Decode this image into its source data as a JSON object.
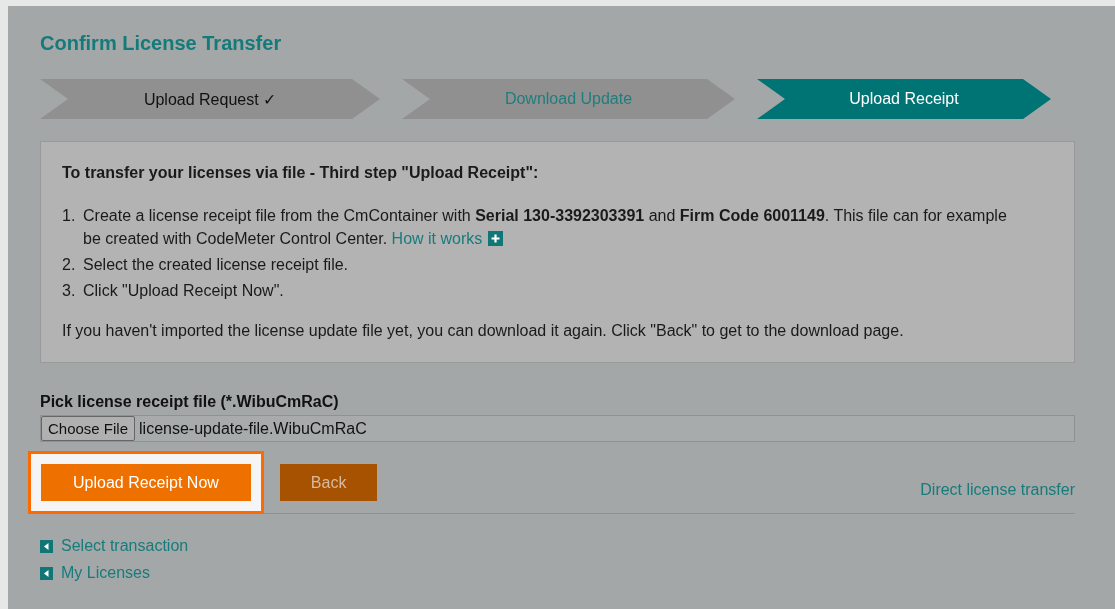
{
  "title": "Confirm License Transfer",
  "steps": [
    {
      "label": "Upload Request ✓",
      "kind": "done"
    },
    {
      "label": "Download Update",
      "kind": "link"
    },
    {
      "label": "Upload Receipt",
      "kind": "current"
    }
  ],
  "instructions": {
    "heading": "To transfer your licenses via file - Third step \"Upload Receipt\":",
    "items": [
      {
        "number": "1.",
        "text": "Create a license receipt file from the CmContainer with **Serial 130-3392303391** and **Firm Code 6001149**. This file can for example be created with CodeMeter Control Center.",
        "link": "How it works"
      },
      {
        "number": "2.",
        "text": "Select the created license receipt file."
      },
      {
        "number": "3.",
        "text": "Click \"Upload Receipt Now\"."
      }
    ],
    "note": "If you haven't imported the license update file yet, you can download it again. Click \"Back\" to get to the download page."
  },
  "file_picker": {
    "label": "Pick license receipt file (*.WibuCmRaC)",
    "button": "Choose File",
    "value": "license-update-file.WibuCmRaC"
  },
  "actions": [
    {
      "label": "Upload Receipt Now",
      "kind": "primary",
      "highlighted": true
    },
    {
      "label": "Back",
      "kind": "secondary",
      "highlighted": false
    }
  ],
  "direct_link": "Direct license transfer",
  "nav_links": [
    "Select transaction",
    "My Licenses"
  ]
}
